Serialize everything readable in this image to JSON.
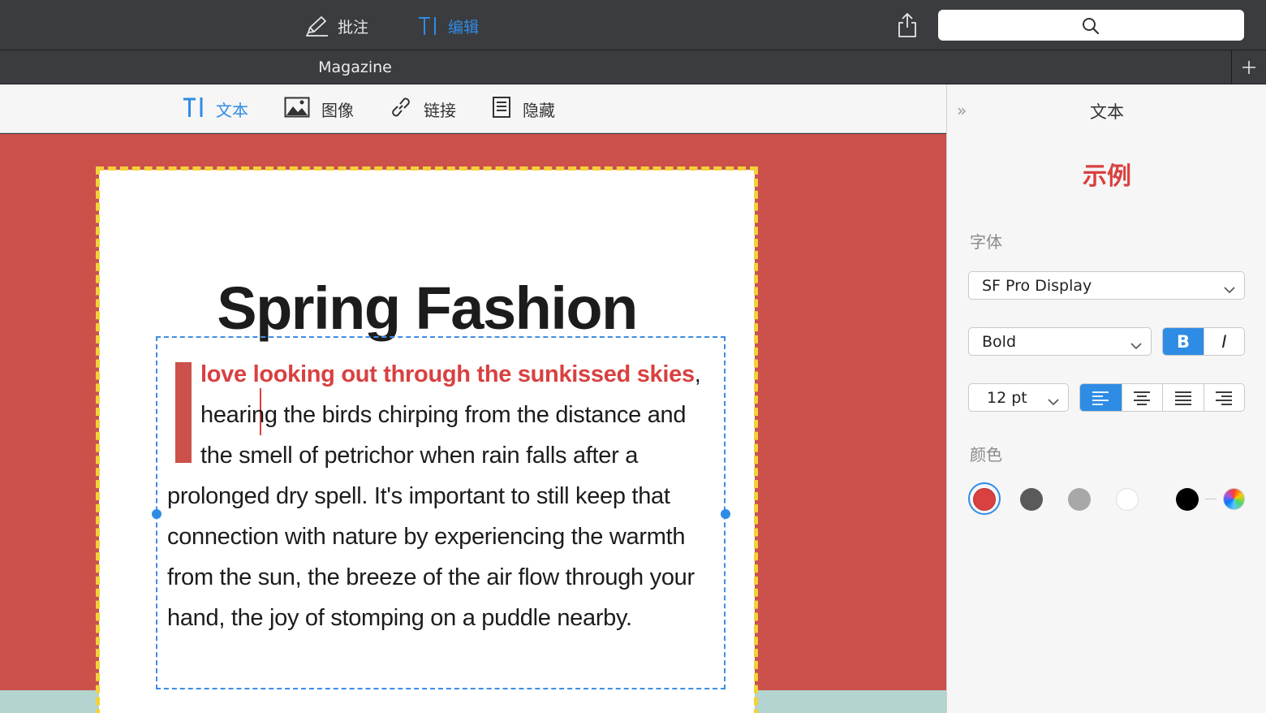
{
  "toolbar": {
    "annotate_label": "批注",
    "edit_label": "编辑",
    "share_icon": "share-icon",
    "search_icon": "search-icon"
  },
  "tabs": {
    "active_tab": "Magazine",
    "add_icon": "plus-icon"
  },
  "edit_tools": [
    {
      "label": "文本",
      "icon": "text-tool-icon",
      "active": true
    },
    {
      "label": "图像",
      "icon": "image-icon",
      "active": false
    },
    {
      "label": "链接",
      "icon": "link-icon",
      "active": false
    },
    {
      "label": "隐藏",
      "icon": "hide-document-icon",
      "active": false
    }
  ],
  "document": {
    "headline": "Spring Fashion",
    "highlight_text": "love looking out through the sunkissed skies",
    "body_text": ", hearing the birds chirping from the distance and the smell of petrichor when rain falls after a prolonged dry spell. It's important to still keep that connection with nature by experiencing the warmth from the sun, the breeze of the air flow through your hand, the joy of stomping on a puddle nearby.",
    "dropcap_color": "#cb514a",
    "page_background": "#cb514a"
  },
  "inspector": {
    "title": "文本",
    "sample": "示例",
    "font_label": "字体",
    "font_family": "SF Pro Display",
    "font_weight": "Bold",
    "bold_label": "B",
    "italic_label": "I",
    "bold_active": true,
    "font_size": "12 pt",
    "alignment": "left",
    "color_label": "颜色",
    "colors": [
      "#d94040",
      "#5a5a5a",
      "#a8a8a8",
      "#ffffff",
      "#000000"
    ],
    "selected_color": "#d94040",
    "accent": "#2f8ce5"
  }
}
